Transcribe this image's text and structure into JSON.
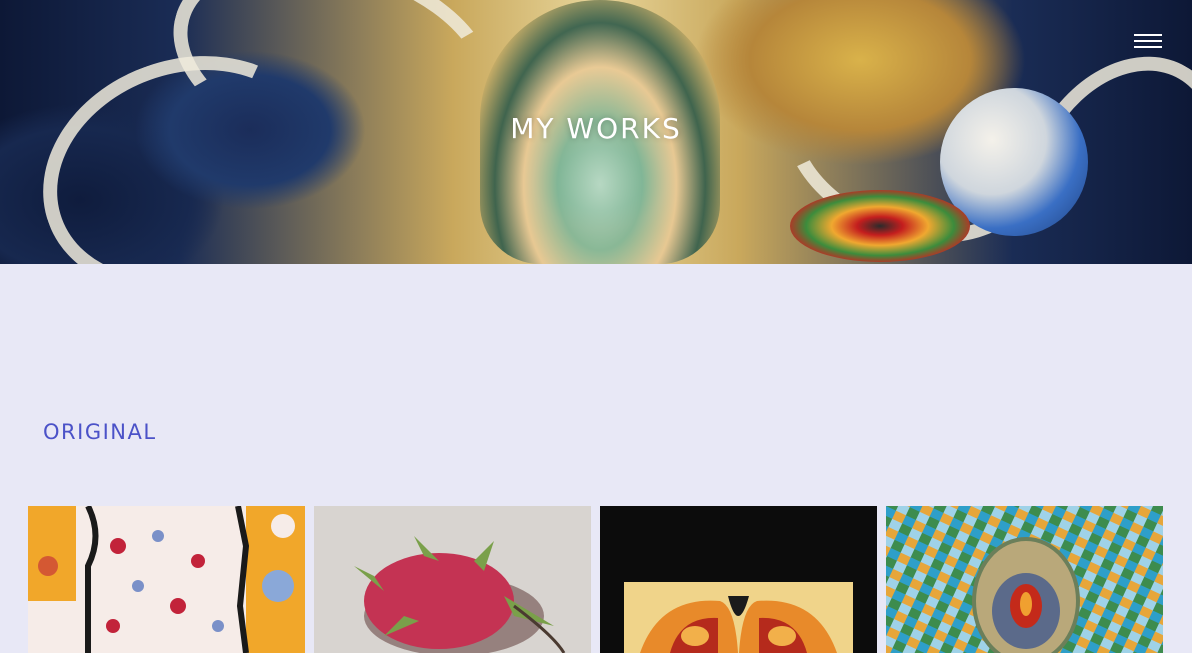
{
  "hero": {
    "title": "MY WORKS"
  },
  "header": {
    "menu_icon": "hamburger-menu-icon"
  },
  "section": {
    "title": "ORIGINAL"
  },
  "gallery": {
    "items": [
      {
        "name": "artwork-pink-pattern"
      },
      {
        "name": "artwork-dragon-fruit"
      },
      {
        "name": "artwork-symmetric-framed"
      },
      {
        "name": "artwork-mosaic-egg"
      }
    ]
  },
  "colors": {
    "background": "#e8e8f6",
    "accent": "#4b52c8"
  }
}
